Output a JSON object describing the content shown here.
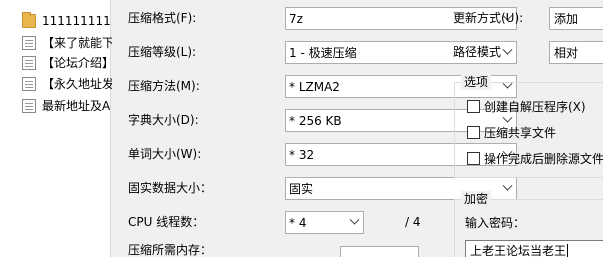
{
  "file_list": [
    {
      "type": "folder",
      "name": "1111111111"
    },
    {
      "type": "document",
      "name": "【来了就能下"
    },
    {
      "type": "document",
      "name": "【论坛介绍】"
    },
    {
      "type": "document",
      "name": "【永久地址发"
    },
    {
      "type": "document",
      "name": "最新地址及A"
    }
  ],
  "settings": {
    "format": {
      "label": "压缩格式(F):",
      "value": "7z"
    },
    "level": {
      "label": "压缩等级(L):",
      "value": "1 - 极速压缩"
    },
    "method": {
      "label": "压缩方法(M):",
      "value": "* LZMA2"
    },
    "dictionary": {
      "label": "字典大小(D):",
      "value": "* 256 KB"
    },
    "word_size": {
      "label": "单词大小(W):",
      "value": "* 32"
    },
    "solid_block": {
      "label": "固实数据大小：",
      "value": "固实"
    },
    "cpu_threads": {
      "label": "CPU 线程数：",
      "value": "* 4",
      "total": "/ 4"
    },
    "memory": {
      "label": "压缩所需内存："
    }
  },
  "right": {
    "update_mode": {
      "label": "更新方式(U):",
      "value": "添加"
    },
    "path_mode": {
      "label": "路径模式",
      "value": "相对"
    },
    "options": {
      "title": "选项",
      "items": [
        "创建自解压程序(X)",
        "压缩共享文件",
        "操作完成后删除源文件"
      ]
    },
    "encryption": {
      "title": "加密",
      "password_label": "输入密码：",
      "password_value": "上老王论坛当老王"
    }
  }
}
